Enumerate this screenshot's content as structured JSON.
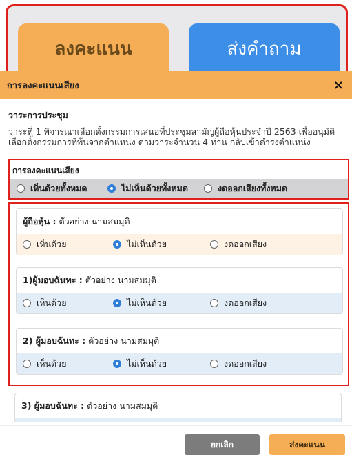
{
  "tabs": {
    "vote_label": "ลงคะแนน",
    "ask_label": "ส่งคำถาม"
  },
  "modal": {
    "title": "การลงคะแนนเสียง",
    "close_icon": "×"
  },
  "agenda": {
    "heading": "วาระการประชุม",
    "text": "วาระที่ 1 พิจารณาเลือกตั้งกรรมการเสนอที่ประชุมสามัญผู้ถือหุ้นประจำปี 2563 เพื่ออนุมัติเลือกตั้งกรรมการที่พ้นจากตำแหน่ง ตามวาระจำนวน 4 ท่าน กลับเข้าดำรงตำแหน่ง"
  },
  "overall_vote": {
    "title": "การลงคะแนนเสียง",
    "options": [
      {
        "label": "เห็นด้วยทั้งหมด",
        "checked": false
      },
      {
        "label": "ไม่เห็นด้วยทั้งหมด",
        "checked": true
      },
      {
        "label": "งดออกเสียงทั้งหมด",
        "checked": false
      }
    ]
  },
  "persons": [
    {
      "prefix": "ผู้ถือหุ้น :",
      "name": "ตัวอย่าง นามสมมุติ",
      "options": [
        "เห็นด้วย",
        "ไม่เห็นด้วย",
        "งดออกเสียง"
      ],
      "selected": 1
    },
    {
      "prefix": "1)ผู้มอบฉันทะ :",
      "name": "ตัวอย่าง นามสมมุติ",
      "options": [
        "เห็นด้วย",
        "ไม่เห็นด้วย",
        "งดออกเสียง"
      ],
      "selected": 1
    },
    {
      "prefix": "2) ผู้มอบฉันทะ :",
      "name": "ตัวอย่าง นามสมมุติ",
      "options": [
        "เห็นด้วย",
        "ไม่เห็นด้วย",
        "งดออกเสียง"
      ],
      "selected": 1
    },
    {
      "prefix": "3) ผู้มอบฉันทะ :",
      "name": "ตัวอย่าง นามสมมุติ"
    }
  ],
  "footer": {
    "cancel_label": "ยกเลิก",
    "submit_label": "ส่งคะแนน"
  },
  "colors": {
    "accent_orange": "#f5ae56",
    "accent_blue": "#3d8ee6",
    "highlight_red": "#e0201c",
    "radio_checked": "#2f7ed8"
  }
}
